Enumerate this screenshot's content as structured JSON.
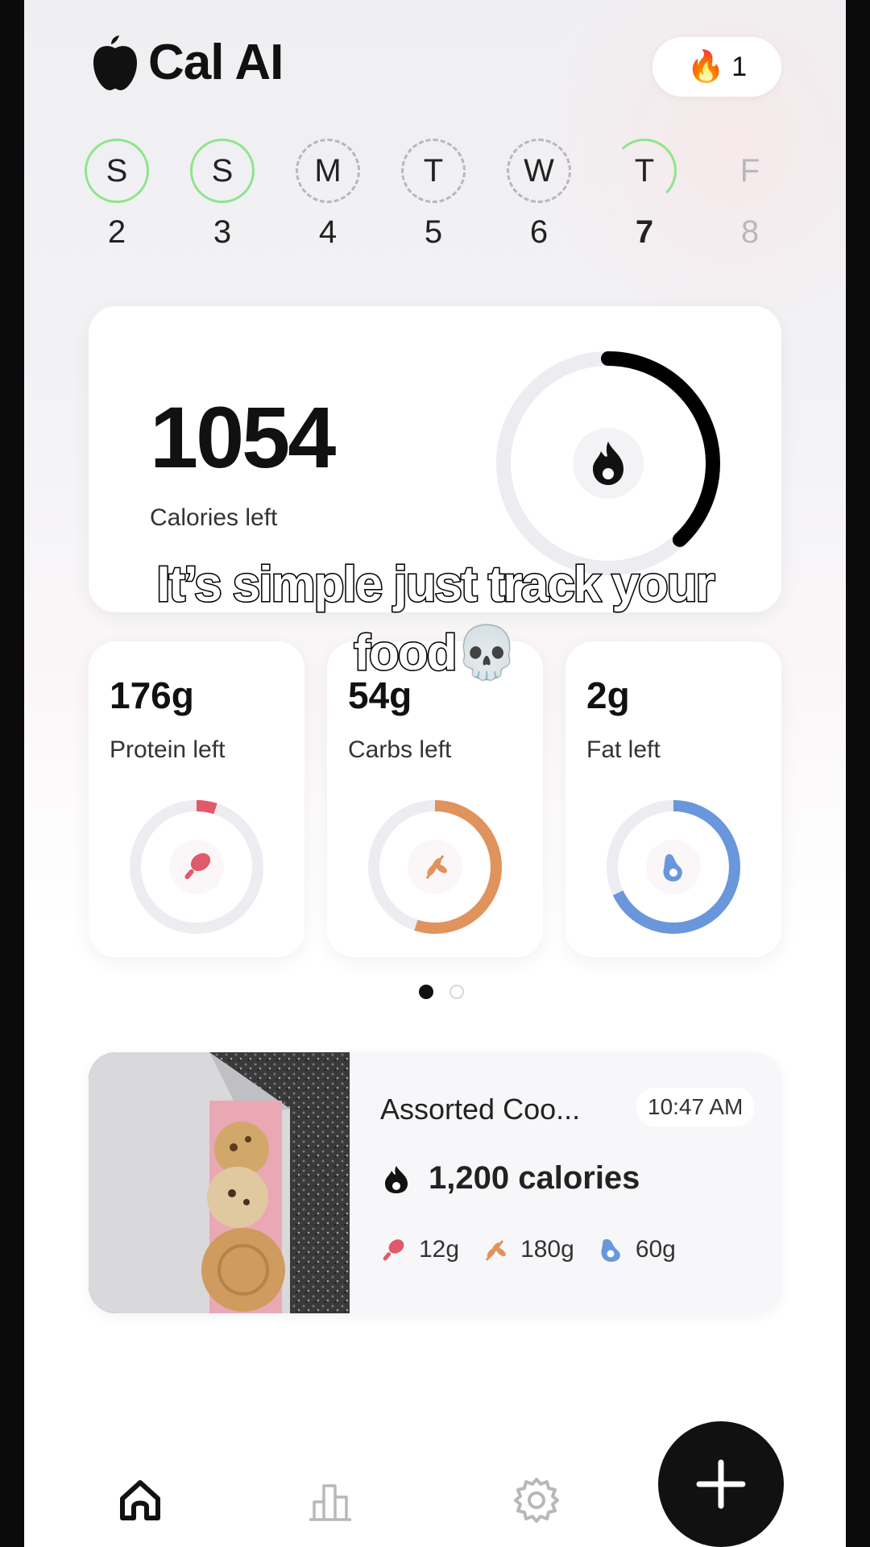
{
  "app": {
    "title": "Cal AI",
    "streak": "1"
  },
  "days": [
    {
      "letter": "S",
      "num": "2",
      "state": "done"
    },
    {
      "letter": "S",
      "num": "3",
      "state": "done"
    },
    {
      "letter": "M",
      "num": "4",
      "state": "dash"
    },
    {
      "letter": "T",
      "num": "5",
      "state": "dash"
    },
    {
      "letter": "W",
      "num": "6",
      "state": "dash"
    },
    {
      "letter": "T",
      "num": "7",
      "state": "today"
    },
    {
      "letter": "F",
      "num": "8",
      "state": "future"
    }
  ],
  "calories": {
    "value": "1054",
    "label": "Calories left",
    "progress": 0.38,
    "ring_color": "#000000"
  },
  "macros": [
    {
      "value": "176g",
      "label": "Protein left",
      "progress": 0.05,
      "color": "#e05a6b",
      "icon": "drumstick-icon"
    },
    {
      "value": "54g",
      "label": "Carbs left",
      "progress": 0.55,
      "color": "#e0935c",
      "icon": "wheat-icon"
    },
    {
      "value": "2g",
      "label": "Fat left",
      "progress": 0.68,
      "color": "#6a96dc",
      "icon": "avocado-icon"
    }
  ],
  "pager": {
    "pages": 2,
    "active": 0
  },
  "food_entry": {
    "name": "Assorted Coo...",
    "time": "10:47 AM",
    "calories": "1,200 calories",
    "protein": "12g",
    "carbs": "180g",
    "fat": "60g"
  },
  "caption": {
    "line1": "It’s simple just track your",
    "line2": "food",
    "emoji": "💀"
  },
  "tabs": [
    "home-icon",
    "analytics-icon",
    "settings-icon"
  ],
  "fab": "plus-icon"
}
